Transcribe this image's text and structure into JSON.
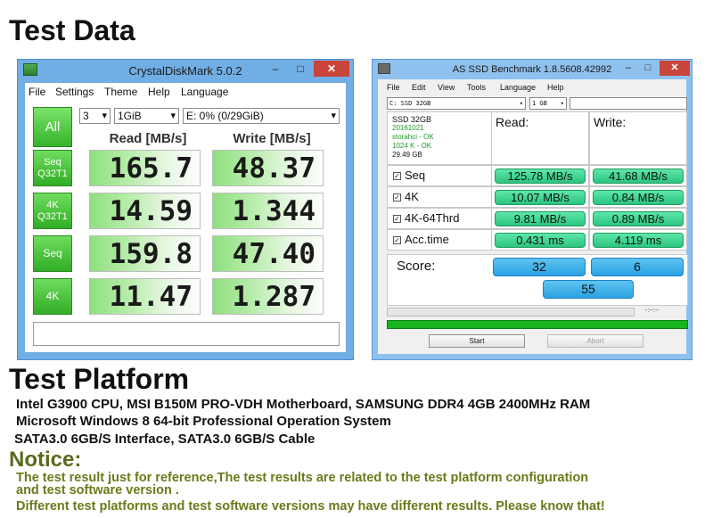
{
  "headings": {
    "test_data": "Test Data",
    "test_platform": "Test Platform"
  },
  "crystaldiskmark": {
    "title": "CrystalDiskMark 5.0.2",
    "window_buttons": {
      "minimize": "–",
      "maximize": "□",
      "close": "✕"
    },
    "menu": [
      "File",
      "Settings",
      "Theme",
      "Help",
      "Language"
    ],
    "all_button": "All",
    "count_select": "3",
    "size_select": "1GiB",
    "drive_select": "E: 0% (0/29GiB)",
    "read_header": "Read [MB/s]",
    "write_header": "Write [MB/s]",
    "rows": [
      {
        "label_line1": "Seq",
        "label_line2": "Q32T1",
        "read": "165.7",
        "write": "48.37"
      },
      {
        "label_line1": "4K",
        "label_line2": "Q32T1",
        "read": "14.59",
        "write": "1.344"
      },
      {
        "label_line1": "Seq",
        "label_line2": "",
        "read": "159.8",
        "write": "47.40"
      },
      {
        "label_line1": "4K",
        "label_line2": "",
        "read": "11.47",
        "write": "1.287"
      }
    ],
    "comment": ""
  },
  "as_ssd": {
    "title": "AS SSD Benchmark 1.8.5608.42992",
    "window_buttons": {
      "minimize": "–",
      "maximize": "□",
      "close": "✕"
    },
    "menu": [
      "File",
      "Edit",
      "View",
      "Tools",
      "Language",
      "Help"
    ],
    "drive_select": "C: SSD 32GB",
    "size_select": "1 GB",
    "info": {
      "model": "SSD 32GB",
      "firmware": "20161021",
      "driver": "storahci - OK",
      "alignment": "1024 K - OK",
      "capacity": "29.49 GB"
    },
    "read_header": "Read:",
    "write_header": "Write:",
    "rows": [
      {
        "label": "Seq",
        "read": "125.78 MB/s",
        "write": "41.68 MB/s"
      },
      {
        "label": "4K",
        "read": "10.07 MB/s",
        "write": "0.84 MB/s"
      },
      {
        "label": "4K-64Thrd",
        "read": "9.81 MB/s",
        "write": "0.89 MB/s"
      },
      {
        "label": "Acc.time",
        "read": "0.431 ms",
        "write": "4.119 ms"
      }
    ],
    "score_label": "Score:",
    "score_read": "32",
    "score_write": "6",
    "score_total": "55",
    "elapsed": "-:--:--",
    "progress": 1.0,
    "start_button": "Start",
    "abort_button": "Abort"
  },
  "platform": {
    "line1": "Intel G3900 CPU, MSI B150M PRO-VDH Motherboard, SAMSUNG DDR4 4GB 2400MHz RAM",
    "line2": "Microsoft Windows 8 64-bit Professional Operation System",
    "line3": "SATA3.0 6GB/S Interface,  SATA3.0 6GB/S Cable"
  },
  "notice": {
    "title": "Notice:",
    "line1": "The test result just for reference,The test results are related to the test platform configuration",
    "line2": "and test software version .",
    "line3": "Different test platforms and test software versions may have different results. Please know that!"
  },
  "colors": {
    "cdm_frame": "#72aee6",
    "cdm_green": "#36b42a",
    "as_frame": "#8fc1ee",
    "as_green_value": "#2cc57f",
    "as_blue_score": "#2aa2e3",
    "notice_text": "#6b7a1a"
  }
}
